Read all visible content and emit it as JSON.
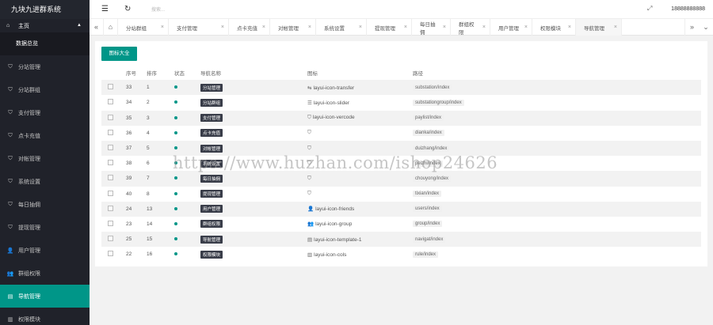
{
  "app": {
    "title": "九块九进群系统"
  },
  "sidebar": {
    "group": {
      "label": "主页",
      "sub": "数据总览"
    },
    "items": [
      {
        "label": "分站管理",
        "icon": "shield-icon"
      },
      {
        "label": "分站群组",
        "icon": "shield-icon"
      },
      {
        "label": "支付管理",
        "icon": "shield-icon"
      },
      {
        "label": "点卡充值",
        "icon": "shield-icon"
      },
      {
        "label": "对帐管理",
        "icon": "shield-icon"
      },
      {
        "label": "系统设置",
        "icon": "shield-icon"
      },
      {
        "label": "每日抽佣",
        "icon": "shield-icon"
      },
      {
        "label": "提现管理",
        "icon": "shield-icon"
      },
      {
        "label": "用户管理",
        "icon": "user-icon"
      },
      {
        "label": "群组权限",
        "icon": "group-icon"
      },
      {
        "label": "导航管理",
        "icon": "template-icon",
        "active": true
      },
      {
        "label": "权限模块",
        "icon": "cols-icon"
      }
    ]
  },
  "header": {
    "search_placeholder": "搜索...",
    "user": "18888888888"
  },
  "tabs": [
    {
      "label": "分站群组"
    },
    {
      "label": "支付管理"
    },
    {
      "label": "点卡充值"
    },
    {
      "label": "对帐管理"
    },
    {
      "label": "系统设置"
    },
    {
      "label": "提现管理"
    },
    {
      "label": "每日抽佣"
    },
    {
      "label": "群组权限"
    },
    {
      "label": "用户管理"
    },
    {
      "label": "权限模块"
    },
    {
      "label": "导航管理",
      "active": true
    }
  ],
  "toolbar": {
    "add_label": "图标大全"
  },
  "table": {
    "headers": {
      "id": "序号",
      "sort": "排序",
      "status": "状态",
      "name": "导航名称",
      "icon": "图标",
      "path": "路径"
    },
    "rows": [
      {
        "id": "33",
        "sort": "1",
        "name": "分站管理",
        "icon_text": "layui-icon-transfer",
        "icon": "transfer-icon",
        "path": "substation/index"
      },
      {
        "id": "34",
        "sort": "2",
        "name": "分站群组",
        "icon_text": "layui-icon-slider",
        "icon": "slider-icon",
        "path": "substationgroup/index"
      },
      {
        "id": "35",
        "sort": "3",
        "name": "支付管理",
        "icon_text": "layui-icon-vercode",
        "icon": "vercode-icon",
        "path": "paylist/index"
      },
      {
        "id": "36",
        "sort": "4",
        "name": "点卡充值",
        "icon_text": "",
        "icon": "vercode-icon",
        "path": "dianka/index"
      },
      {
        "id": "37",
        "sort": "5",
        "name": "对帐管理",
        "icon_text": "",
        "icon": "vercode-icon",
        "path": "duizhang/index"
      },
      {
        "id": "38",
        "sort": "6",
        "name": "系统设置",
        "icon_text": "",
        "icon": "vercode-icon",
        "path": "peizhi/index"
      },
      {
        "id": "39",
        "sort": "7",
        "name": "每日抽佣",
        "icon_text": "",
        "icon": "vercode-icon",
        "path": "chouyong/index"
      },
      {
        "id": "40",
        "sort": "8",
        "name": "提现管理",
        "icon_text": "",
        "icon": "vercode-icon",
        "path": "tixian/index"
      },
      {
        "id": "24",
        "sort": "13",
        "name": "用户管理",
        "icon_text": "layui-icon-friends",
        "icon": "friends-icon",
        "path": "users/index"
      },
      {
        "id": "23",
        "sort": "14",
        "name": "群组权限",
        "icon_text": "layui-icon-group",
        "icon": "group-icon",
        "path": "group/index"
      },
      {
        "id": "25",
        "sort": "15",
        "name": "导航管理",
        "icon_text": "layui-icon-template-1",
        "icon": "template-icon",
        "path": "navigat/index"
      },
      {
        "id": "22",
        "sort": "16",
        "name": "权限模块",
        "icon_text": "layui-icon-cols",
        "icon": "cols-icon",
        "path": "rule/index"
      }
    ]
  },
  "watermark": "https://www.huzhan.com/ishop24626",
  "colors": {
    "accent": "#009688",
    "sidebar": "#20222a",
    "badge": "#393d49"
  }
}
